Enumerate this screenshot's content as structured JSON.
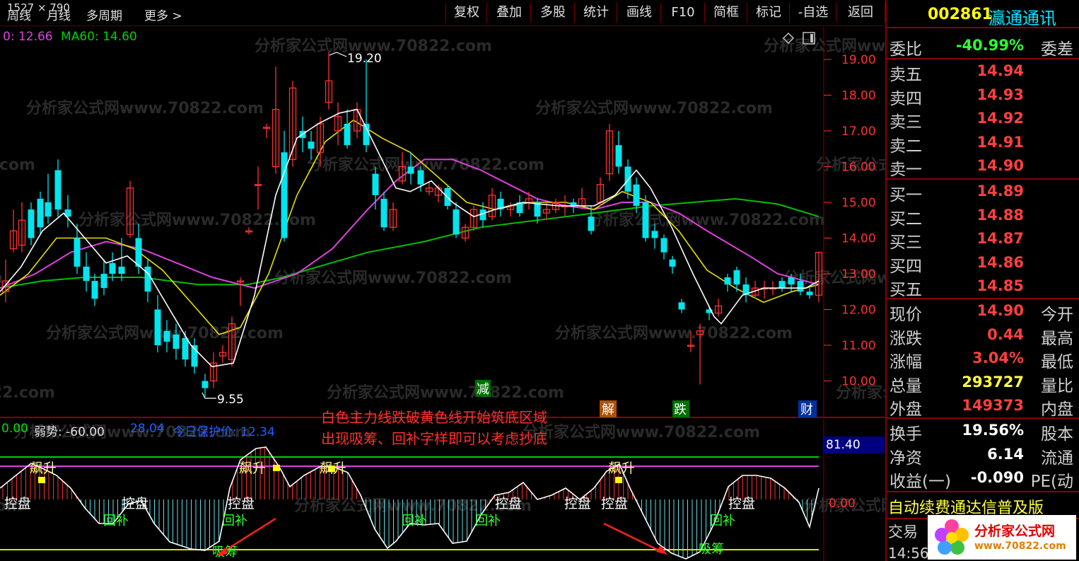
{
  "topbar": {
    "coords": "1527 × 790",
    "periods": [
      "周线",
      "月线",
      "多周期",
      "更多 >"
    ],
    "buttons": [
      "复权",
      "叠加",
      "多股",
      "统计",
      "画线",
      "F10",
      "简框",
      "标记",
      "-自选",
      "返回"
    ]
  },
  "stock": {
    "code": "002861",
    "name": "瀛通通讯"
  },
  "legend": {
    "ma_prefix": "0: 12.66",
    "ma60": "MA60: 14.60"
  },
  "watermark": "分析家公式网www.70822.com",
  "price_axis": [
    "19.00",
    "18.00",
    "17.00",
    "16.00",
    "15.00",
    "14.00",
    "13.00",
    "12.00",
    "11.00",
    "10.00"
  ],
  "annotations": {
    "high": "19.20",
    "low": "9.55"
  },
  "markers": {
    "jian": "减",
    "jie": "解",
    "die": "跌",
    "cai": "财"
  },
  "note": {
    "line1": "白色主力线跌破黄色线开始筑底区域",
    "line2": "出现吸筹、回补字样即可以考虑抄底"
  },
  "indicator": {
    "v0": "0.00",
    "weak": "弱势: -60.00",
    "blue_val": "28.04",
    "protect": "今日保护价: 12.34",
    "axis_top": "81.40",
    "axis_zero": "0.00",
    "labels": {
      "piaosheng": "飙升",
      "kongpan": "控盘",
      "huibu": "回补",
      "xichou": "吸筹"
    }
  },
  "quote": {
    "webi": {
      "k": "委比",
      "v": "-40.99%",
      "t": "委差"
    },
    "asks": [
      {
        "k": "卖五",
        "v": "14.94"
      },
      {
        "k": "卖四",
        "v": "14.93"
      },
      {
        "k": "卖三",
        "v": "14.92"
      },
      {
        "k": "卖二",
        "v": "14.91"
      },
      {
        "k": "卖一",
        "v": "14.90"
      }
    ],
    "bids": [
      {
        "k": "买一",
        "v": "14.89"
      },
      {
        "k": "买二",
        "v": "14.88"
      },
      {
        "k": "买三",
        "v": "14.87"
      },
      {
        "k": "买四",
        "v": "14.86"
      },
      {
        "k": "买五",
        "v": "14.85"
      }
    ],
    "stats": [
      {
        "k": "现价",
        "v": "14.90",
        "t": "今开"
      },
      {
        "k": "涨跌",
        "v": "0.44",
        "t": "最高"
      },
      {
        "k": "涨幅",
        "v": "3.04%",
        "t": "最低"
      },
      {
        "k": "总量",
        "v": "293727",
        "t": "量比"
      },
      {
        "k": "外盘",
        "v": "149373",
        "t": "内盘"
      }
    ],
    "stats2": [
      {
        "k": "换手",
        "v": "19.56%",
        "t": "股本"
      },
      {
        "k": "净资",
        "v": "6.14",
        "t": "流通"
      },
      {
        "k": "收益(一)",
        "v": "-0.090",
        "t": "PE(动"
      }
    ]
  },
  "ad": "自动续费通达信普及版",
  "trade": "交易",
  "time": "14:56",
  "logo": {
    "text": "分析家公式网",
    "url": "www.70822.com"
  },
  "colors": {
    "red": "#ff3030",
    "cyan": "#00e5ee",
    "yellow": "#e8e000",
    "magenta": "#e040e0",
    "green": "#00c000",
    "white": "#ffffff"
  }
}
